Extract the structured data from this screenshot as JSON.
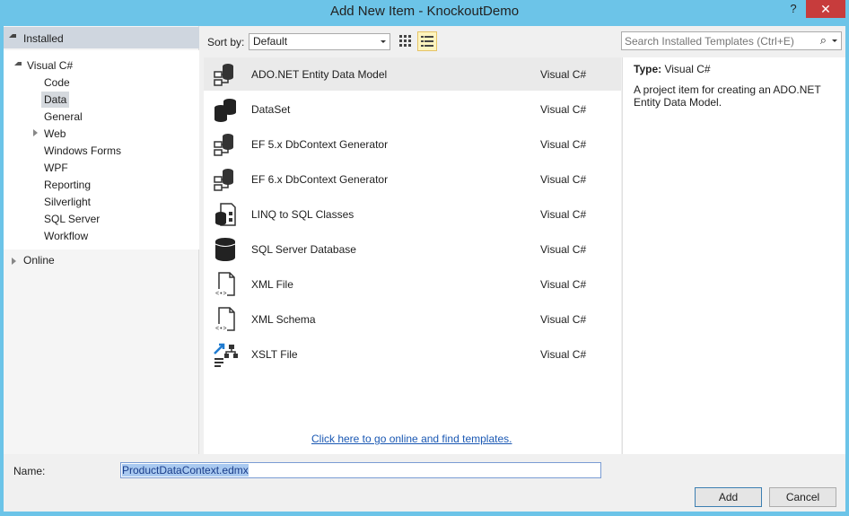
{
  "window": {
    "title": "Add New Item - KnockoutDemo",
    "help_glyph": "?",
    "close_glyph": "✕"
  },
  "tree": {
    "header": "Installed",
    "root": "Visual C#",
    "children": [
      "Code",
      "Data",
      "General",
      "Web",
      "Windows Forms",
      "WPF",
      "Reporting",
      "Silverlight",
      "SQL Server",
      "Workflow"
    ],
    "selected": "Data",
    "online": "Online"
  },
  "toolbar": {
    "sort_label": "Sort by:",
    "sort_value": "Default",
    "search_placeholder": "Search Installed Templates (Ctrl+E)"
  },
  "templates": [
    {
      "name": "ADO.NET Entity Data Model",
      "lang": "Visual C#",
      "icon": "entity-model-icon"
    },
    {
      "name": "DataSet",
      "lang": "Visual C#",
      "icon": "dataset-icon"
    },
    {
      "name": "EF 5.x DbContext Generator",
      "lang": "Visual C#",
      "icon": "ef-generator-icon"
    },
    {
      "name": "EF 6.x DbContext Generator",
      "lang": "Visual C#",
      "icon": "ef-generator-icon"
    },
    {
      "name": "LINQ to SQL Classes",
      "lang": "Visual C#",
      "icon": "linq-icon"
    },
    {
      "name": "SQL Server Database",
      "lang": "Visual C#",
      "icon": "database-icon"
    },
    {
      "name": "XML File",
      "lang": "Visual C#",
      "icon": "xml-file-icon"
    },
    {
      "name": "XML Schema",
      "lang": "Visual C#",
      "icon": "xml-schema-icon"
    },
    {
      "name": "XSLT File",
      "lang": "Visual C#",
      "icon": "xslt-icon"
    }
  ],
  "online_link": "Click here to go online and find templates.",
  "details": {
    "type_label": "Type:",
    "type_value": "Visual C#",
    "description": "A project item for creating an ADO.NET Entity Data Model."
  },
  "footer": {
    "name_label": "Name:",
    "name_value": "ProductDataContext.edmx",
    "add_label": "Add",
    "cancel_label": "Cancel"
  }
}
